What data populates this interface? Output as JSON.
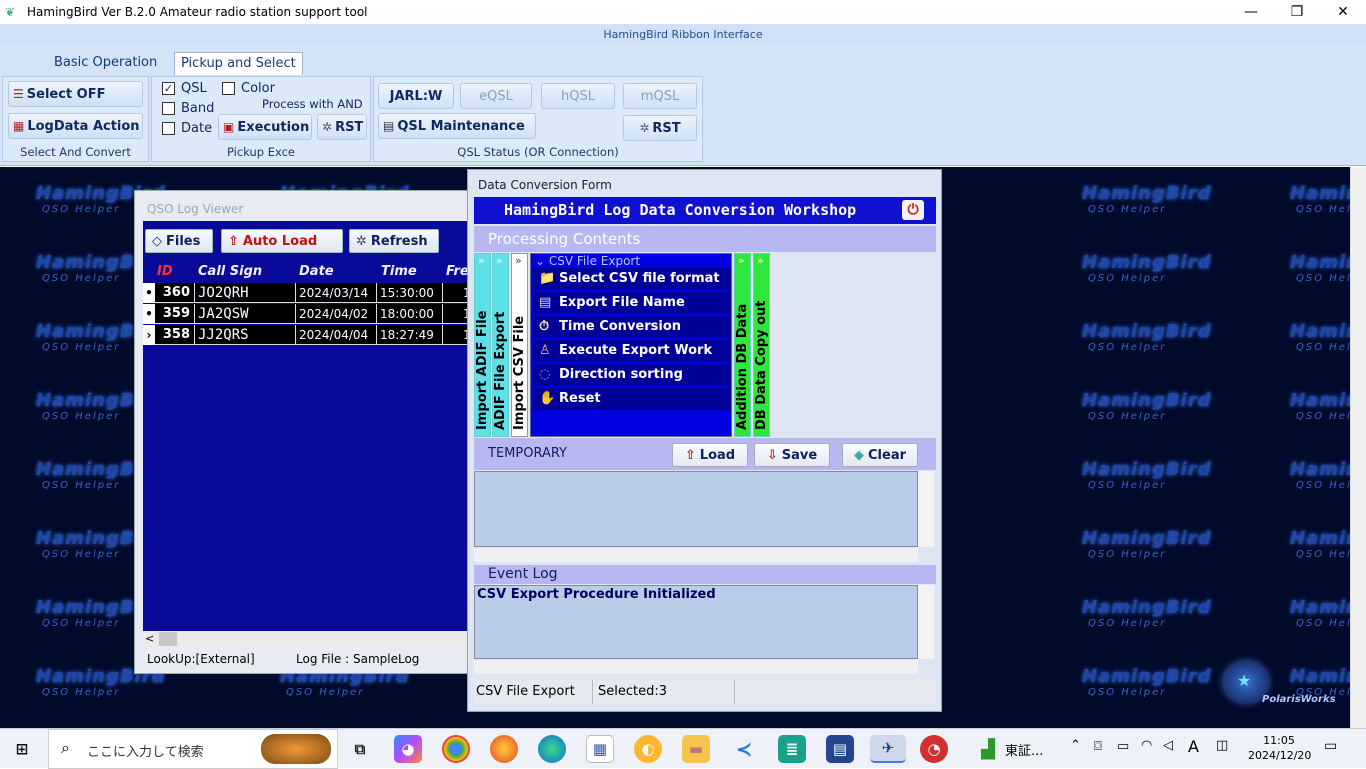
{
  "window": {
    "title": "HamingBird Ver B.2.0   Amateur radio station support tool",
    "min": "—",
    "restore": "❐",
    "close": "✕"
  },
  "ribbon": {
    "caption": "HamingBird Ribbon Interface",
    "tabs": [
      "Basic Operation",
      "Pickup and Select"
    ],
    "select_convert": {
      "select_off": "Select OFF",
      "logdata_action": "LogData Action",
      "caption": "Select And Convert"
    },
    "pickup": {
      "qsl": "QSL",
      "band": "Band",
      "date": "Date",
      "color": "Color",
      "and_note": "Process with AND",
      "execution": "Execution",
      "rst": "RST",
      "caption": "Pickup Exce",
      "check": "✓"
    },
    "qsl_status": {
      "jarl": "JARL:W",
      "eqsl": "eQSL",
      "hqsl": "hQSL",
      "mqsl": "mQSL",
      "maintenance": "QSL Maintenance",
      "rst": "RST",
      "caption": "QSL Status (OR Connection)"
    }
  },
  "watermark": {
    "title": "HamingBird",
    "sub": "QSO Helper"
  },
  "qso_viewer": {
    "caption": "QSO Log Viewer",
    "files": "Files",
    "auto_load": "Auto Load",
    "refresh": "Refresh",
    "columns": [
      "ID",
      "Call Sign",
      "Date",
      "Time",
      "Fre"
    ],
    "rows": [
      {
        "mark": "•",
        "id": "360",
        "call": "JO2QRH",
        "date": "2024/03/14",
        "time": "15:30:00",
        "fre": "1"
      },
      {
        "mark": "•",
        "id": "359",
        "call": "JA2QSW",
        "date": "2024/04/02",
        "time": "18:00:00",
        "fre": "1"
      },
      {
        "mark": "›",
        "id": "358",
        "call": "JJ2QRS",
        "date": "2024/04/04",
        "time": "18:27:49",
        "fre": "1"
      }
    ],
    "lookup": "LookUp:[External]",
    "logfile": "Log File : SampleLog",
    "scroll_left": "<"
  },
  "conversion": {
    "caption": "Data Conversion Form",
    "header": "HamingBird Log Data Conversion Workshop",
    "power": "⏻",
    "processing": "Processing Contents",
    "vtabs": [
      "Import ADIF File",
      "ADIF File Export",
      "Import CSV File",
      "Addition DB Data",
      "DB Data Copy out"
    ],
    "tab_arrows": "»",
    "menu_title": "CSV File Export",
    "menu_items": [
      "Select CSV file format",
      "Export File Name Setup",
      "Time Conversion",
      "Execute Export Work",
      "Direction sorting",
      "Reset"
    ],
    "menu_icons": [
      "📁",
      "▤",
      "⏱",
      "♙",
      "◌",
      "✋"
    ],
    "temporary": "TEMPORARY",
    "load": "Load",
    "save": "Save",
    "clear": "Clear",
    "event_log": "Event Log",
    "event_text": "CSV Export Procedure Initialized",
    "status_left": "CSV File Export",
    "status_sel": "Selected:3"
  },
  "brand": "PolarisWorks",
  "taskbar": {
    "search": "ここに入力して検索",
    "app_label": "東証...",
    "time": "11:05",
    "date": "2024/12/20",
    "ime": "A"
  }
}
